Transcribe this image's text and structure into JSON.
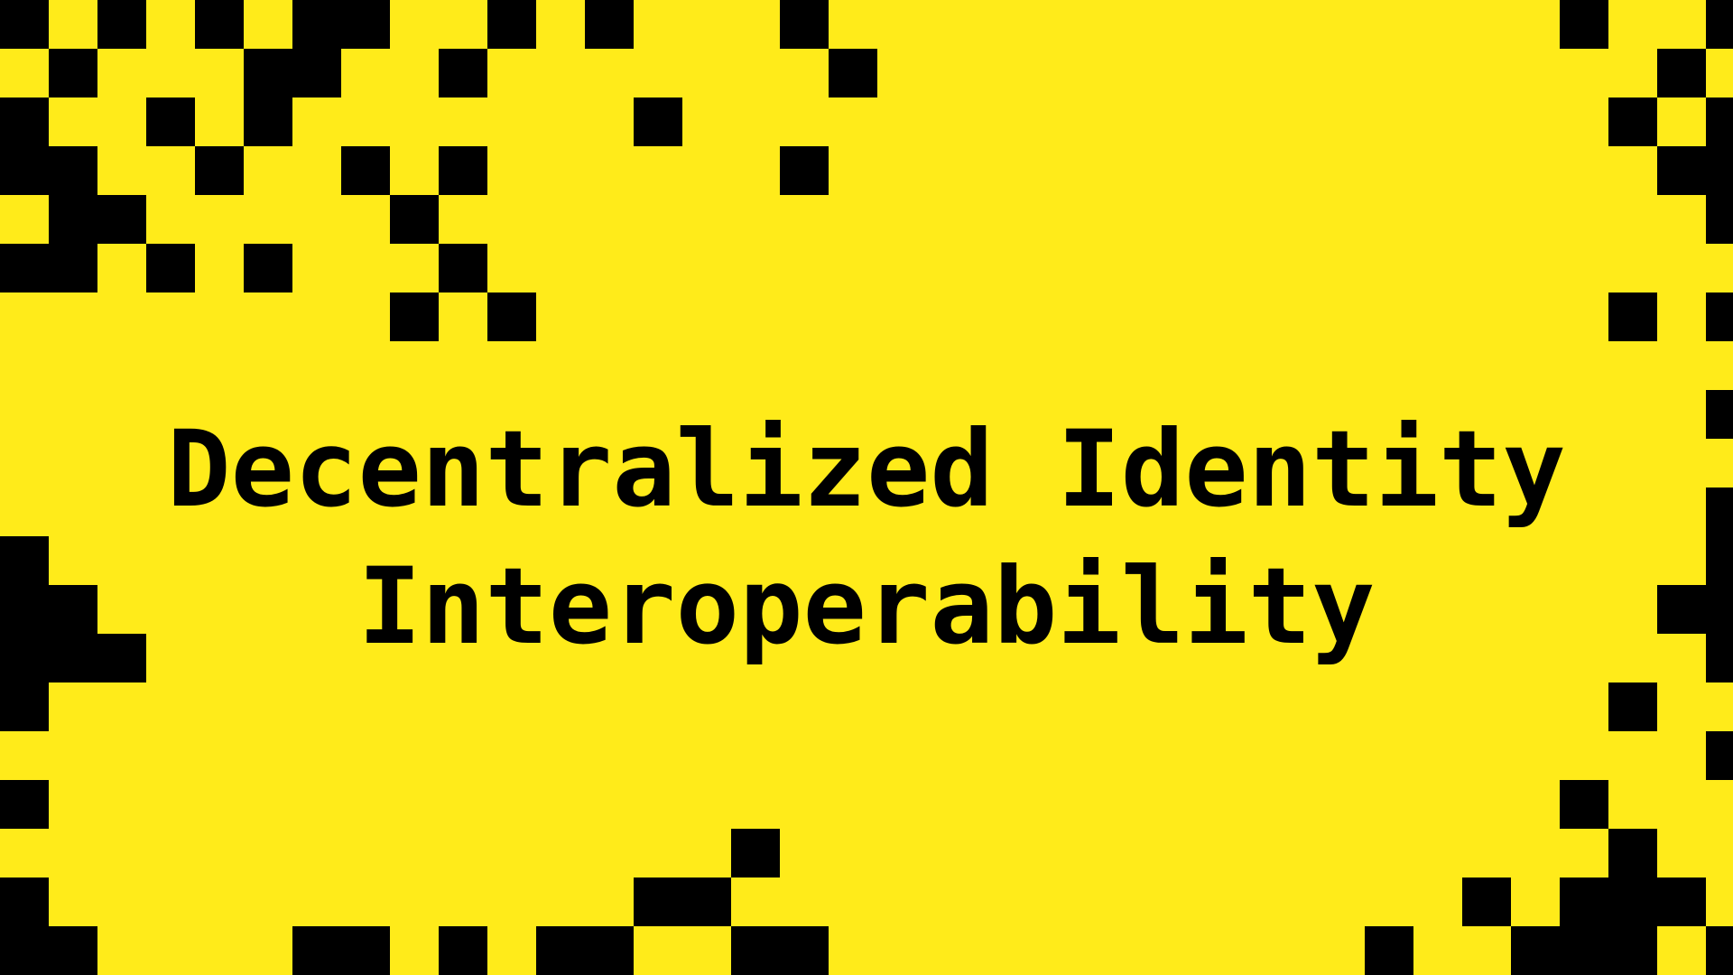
{
  "banner": {
    "title_line_1": "Decentralized Identity",
    "title_line_2": "Interoperability"
  },
  "colors": {
    "background": "#FFEB1A",
    "ink": "#000000"
  }
}
